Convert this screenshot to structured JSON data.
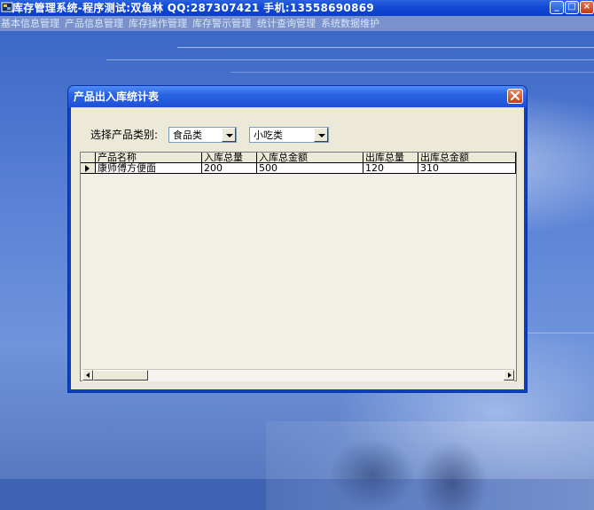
{
  "app": {
    "title": "库存管理系统-程序测试:双鱼林 QQ:287307421 手机:13558690869",
    "minimize_glyph": "_",
    "maximize_glyph": "□",
    "close_glyph": "×"
  },
  "menu": {
    "items": [
      {
        "label": "基本信息管理"
      },
      {
        "label": "产品信息管理"
      },
      {
        "label": "库存操作管理"
      },
      {
        "label": "库存警示管理"
      },
      {
        "label": "统计查询管理"
      },
      {
        "label": "系统数据维护"
      }
    ]
  },
  "dialog": {
    "title": "产品出入库统计表",
    "category_label": "选择产品类别:",
    "category_value": "食品类",
    "subcategory_value": "小吃类"
  },
  "grid": {
    "columns": [
      "产品名称",
      "入库总量",
      "入库总金额",
      "出库总量",
      "出库总金额"
    ],
    "rows": [
      [
        "康师傅方便面",
        "200",
        "500",
        "120",
        "310"
      ]
    ]
  },
  "colors": {
    "title_bar": "#1149d6",
    "dialog_body": "#ece9d8",
    "close_button": "#c4401a"
  }
}
